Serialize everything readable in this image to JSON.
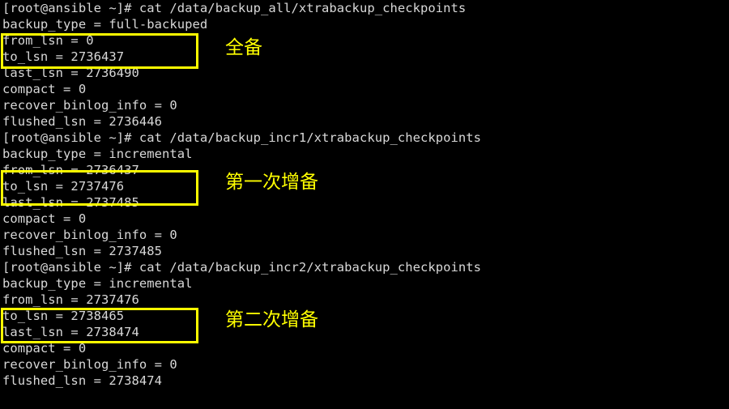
{
  "terminal": {
    "background_color": "#000000",
    "text_color": "#d8d8d8",
    "highlight_color": "#ffff00",
    "line_height_px": 20,
    "lines": [
      {
        "n": 0,
        "text": "[root@ansible ~]# cat /data/backup_all/xtrabackup_checkpoints"
      },
      {
        "n": 1,
        "text": "backup_type = full-backuped"
      },
      {
        "n": 2,
        "text": "from_lsn = 0"
      },
      {
        "n": 3,
        "text": "to_lsn = 2736437"
      },
      {
        "n": 4,
        "text": "last_lsn = 2736490"
      },
      {
        "n": 5,
        "text": "compact = 0"
      },
      {
        "n": 6,
        "text": "recover_binlog_info = 0"
      },
      {
        "n": 7,
        "text": "flushed_lsn = 2736446"
      },
      {
        "n": 8,
        "text": "[root@ansible ~]# cat /data/backup_incr1/xtrabackup_checkpoints"
      },
      {
        "n": 9,
        "text": "backup_type = incremental"
      },
      {
        "n": 10,
        "text": "from_lsn = 2736437"
      },
      {
        "n": 11,
        "text": "to_lsn = 2737476"
      },
      {
        "n": 12,
        "text": "last_lsn = 2737485"
      },
      {
        "n": 13,
        "text": "compact = 0"
      },
      {
        "n": 14,
        "text": "recover_binlog_info = 0"
      },
      {
        "n": 15,
        "text": "flushed_lsn = 2737485"
      },
      {
        "n": 16,
        "text": "[root@ansible ~]# cat /data/backup_incr2/xtrabackup_checkpoints"
      },
      {
        "n": 17,
        "text": "backup_type = incremental"
      },
      {
        "n": 18,
        "text": "from_lsn = 2737476"
      },
      {
        "n": 19,
        "text": "to_lsn = 2738465"
      },
      {
        "n": 20,
        "text": "last_lsn = 2738474"
      },
      {
        "n": 21,
        "text": "compact = 0"
      },
      {
        "n": 22,
        "text": "recover_binlog_info = 0"
      },
      {
        "n": 23,
        "text": "flushed_lsn = 2738474"
      }
    ]
  },
  "annotations": [
    {
      "label": "全备",
      "color": "#ffff00"
    },
    {
      "label": "第一次增备",
      "color": "#ffff00"
    },
    {
      "label": "第二次增备",
      "color": "#ffff00"
    }
  ],
  "highlight_boxes": [
    {
      "label": "full-backup-lsn-box",
      "color": "#ffff00"
    },
    {
      "label": "incr1-lsn-box",
      "color": "#ffff00"
    },
    {
      "label": "incr2-lsn-box",
      "color": "#ffff00"
    }
  ]
}
